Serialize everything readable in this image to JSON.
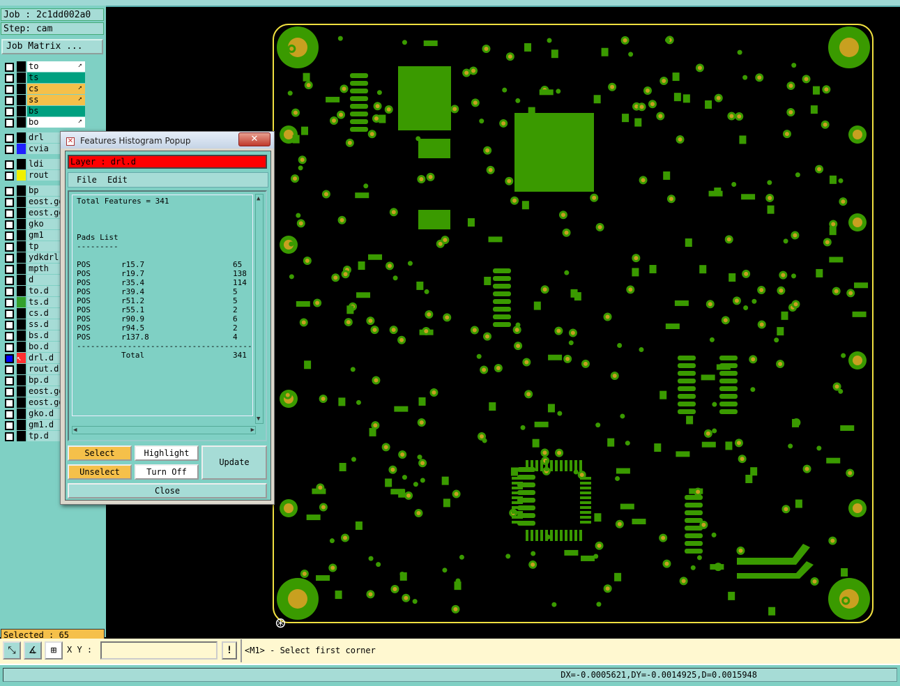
{
  "job_label": "Job : 2c1dd002a0",
  "step_label": "Step: cam",
  "job_matrix_button": "Job Matrix ...",
  "layers": [
    {
      "name": "to",
      "color": "#ffffff",
      "selected": false,
      "has_arrow": true
    },
    {
      "name": "ts",
      "color": "#00a080",
      "selected": false,
      "has_arrow": false
    },
    {
      "name": "cs",
      "color": "#f5c04a",
      "selected": false,
      "has_arrow": true
    },
    {
      "name": "ss",
      "color": "#f5c04a",
      "selected": false,
      "has_arrow": true
    },
    {
      "name": "bs",
      "color": "#00a080",
      "selected": false,
      "has_arrow": false
    },
    {
      "name": "bo",
      "color": "#ffffff",
      "selected": false,
      "has_arrow": true
    },
    {
      "name": "drl",
      "color": "#a6dcd6",
      "selected": false,
      "has_arrow": false
    },
    {
      "name": "cvia",
      "color": "#a6dcd6",
      "selected": false,
      "has_arrow": false,
      "swatch": "#2020ff"
    },
    {
      "name": "ldi",
      "color": "#a6dcd6",
      "selected": false,
      "has_arrow": false
    },
    {
      "name": "rout",
      "color": "#a6dcd6",
      "selected": false,
      "has_arrow": false,
      "swatch": "#f0f000"
    },
    {
      "name": "bp",
      "color": "#a6dcd6"
    },
    {
      "name": "eost.gd",
      "color": "#a6dcd6"
    },
    {
      "name": "eost.gd",
      "color": "#a6dcd6"
    },
    {
      "name": "gko",
      "color": "#a6dcd6"
    },
    {
      "name": "gm1",
      "color": "#a6dcd6"
    },
    {
      "name": "tp",
      "color": "#a6dcd6"
    },
    {
      "name": "ydkdrl",
      "color": "#a6dcd6"
    },
    {
      "name": "mpth",
      "color": "#a6dcd6"
    },
    {
      "name": "d",
      "color": "#a6dcd6"
    },
    {
      "name": "to.d",
      "color": "#a6dcd6"
    },
    {
      "name": "ts.d",
      "color": "#a6dcd6",
      "swatch": "#33a02c"
    },
    {
      "name": "cs.d",
      "color": "#a6dcd6"
    },
    {
      "name": "ss.d",
      "color": "#a6dcd6"
    },
    {
      "name": "bs.d",
      "color": "#a6dcd6"
    },
    {
      "name": "bo.d",
      "color": "#a6dcd6"
    },
    {
      "name": "drl.d",
      "color": "#a6dcd6",
      "selected": true,
      "swatch": "#ff3030"
    },
    {
      "name": "rout.d",
      "color": "#a6dcd6"
    },
    {
      "name": "bp.d",
      "color": "#a6dcd6"
    },
    {
      "name": "eost.gd",
      "color": "#a6dcd6"
    },
    {
      "name": "eost.gd",
      "color": "#a6dcd6"
    },
    {
      "name": "gko.d",
      "color": "#a6dcd6"
    },
    {
      "name": "gm1.d",
      "color": "#a6dcd6"
    },
    {
      "name": "tp.d",
      "color": "#a6dcd6"
    }
  ],
  "selected_label": "Selected : 65",
  "popup": {
    "title": "Features Histogram Popup",
    "close_x": "✕",
    "layer_label": "Layer :  drl.d",
    "menu": {
      "file": "File",
      "edit": "Edit"
    },
    "total_features": "Total Features = 341",
    "pads_list_title": "Pads List",
    "pads_list_underline": "---------",
    "pads": [
      {
        "type": "POS",
        "symbol": "r15.7",
        "count": "65"
      },
      {
        "type": "POS",
        "symbol": "r19.7",
        "count": "138"
      },
      {
        "type": "POS",
        "symbol": "r35.4",
        "count": "114"
      },
      {
        "type": "POS",
        "symbol": "r39.4",
        "count": "5"
      },
      {
        "type": "POS",
        "symbol": "r51.2",
        "count": "5"
      },
      {
        "type": "POS",
        "symbol": "r55.1",
        "count": "2"
      },
      {
        "type": "POS",
        "symbol": "r90.9",
        "count": "6"
      },
      {
        "type": "POS",
        "symbol": "r94.5",
        "count": "2"
      },
      {
        "type": "POS",
        "symbol": "r137.8",
        "count": "4"
      }
    ],
    "separator": "------------------------------------------",
    "total_label": "Total",
    "total_value": "341",
    "buttons": {
      "select": "Select",
      "highlight": "Highlight",
      "update": "Update",
      "unselect": "Unselect",
      "turn_off": "Turn Off",
      "close": "Close"
    }
  },
  "bottom": {
    "xy_label": "X Y :",
    "xy_value": "",
    "warn_icon": "!",
    "prompt": "<M1> - Select first corner",
    "status": "DX=-0.0005621,DY=-0.0014925,D=0.0015948"
  },
  "colors": {
    "panel": "#7fd0c4",
    "board_outline": "#f0e040",
    "pad_green": "#3a9a00",
    "drill_gold": "#c8a020",
    "popup_layer_bar": "#ff0000"
  }
}
